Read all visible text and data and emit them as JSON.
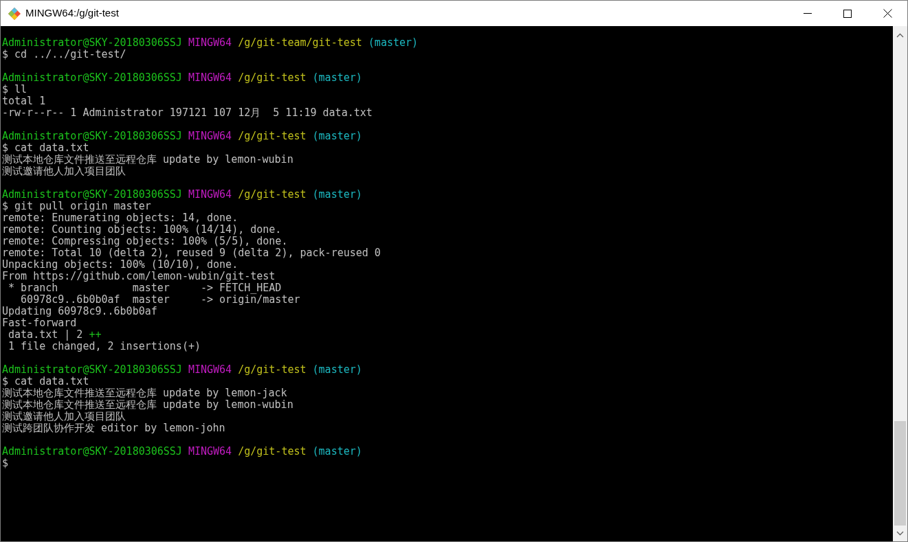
{
  "window": {
    "title": "MINGW64:/g/git-test"
  },
  "blocks": [
    {
      "prompt": {
        "user": "Administrator@SKY-20180306SSJ",
        "system": "MINGW64",
        "path": "/g/git-team/git-test",
        "branch": "(master)"
      },
      "lines": [
        {
          "text": "$ cd ../../git-test/"
        }
      ]
    },
    {
      "prompt": {
        "user": "Administrator@SKY-20180306SSJ",
        "system": "MINGW64",
        "path": "/g/git-test",
        "branch": "(master)"
      },
      "lines": [
        {
          "text": "$ ll"
        },
        {
          "text": "total 1"
        },
        {
          "text": "-rw-r--r-- 1 Administrator 197121 107 12月  5 11:19 data.txt"
        }
      ]
    },
    {
      "prompt": {
        "user": "Administrator@SKY-20180306SSJ",
        "system": "MINGW64",
        "path": "/g/git-test",
        "branch": "(master)"
      },
      "lines": [
        {
          "text": "$ cat data.txt"
        },
        {
          "text": "测试本地仓库文件推送至远程仓库 update by lemon-wubin"
        },
        {
          "text": "测试邀请他人加入项目团队"
        }
      ]
    },
    {
      "prompt": {
        "user": "Administrator@SKY-20180306SSJ",
        "system": "MINGW64",
        "path": "/g/git-test",
        "branch": "(master)"
      },
      "lines": [
        {
          "text": "$ git pull origin master"
        },
        {
          "text": "remote: Enumerating objects: 14, done."
        },
        {
          "text": "remote: Counting objects: 100% (14/14), done."
        },
        {
          "text": "remote: Compressing objects: 100% (5/5), done."
        },
        {
          "text": "remote: Total 10 (delta 2), reused 9 (delta 2), pack-reused 0"
        },
        {
          "text": "Unpacking objects: 100% (10/10), done."
        },
        {
          "text": "From https://github.com/lemon-wubin/git-test"
        },
        {
          "text": " * branch            master     -> FETCH_HEAD"
        },
        {
          "text": "   60978c9..6b0b0af  master     -> origin/master"
        },
        {
          "text": "Updating 60978c9..6b0b0af"
        },
        {
          "text": "Fast-forward"
        },
        {
          "text": " data.txt | 2 ",
          "added": "++"
        },
        {
          "text": " 1 file changed, 2 insertions(+)"
        }
      ]
    },
    {
      "prompt": {
        "user": "Administrator@SKY-20180306SSJ",
        "system": "MINGW64",
        "path": "/g/git-test",
        "branch": "(master)"
      },
      "lines": [
        {
          "text": "$ cat data.txt"
        },
        {
          "text": "测试本地仓库文件推送至远程仓库 update by lemon-jack"
        },
        {
          "text": "测试本地仓库文件推送至远程仓库 update by lemon-wubin"
        },
        {
          "text": "测试邀请他人加入项目团队"
        },
        {
          "text": "测试跨团队协作开发 editor by lemon-john"
        }
      ]
    },
    {
      "prompt": {
        "user": "Administrator@SKY-20180306SSJ",
        "system": "MINGW64",
        "path": "/g/git-test",
        "branch": "(master)"
      },
      "lines": [
        {
          "text": "$"
        }
      ]
    }
  ]
}
